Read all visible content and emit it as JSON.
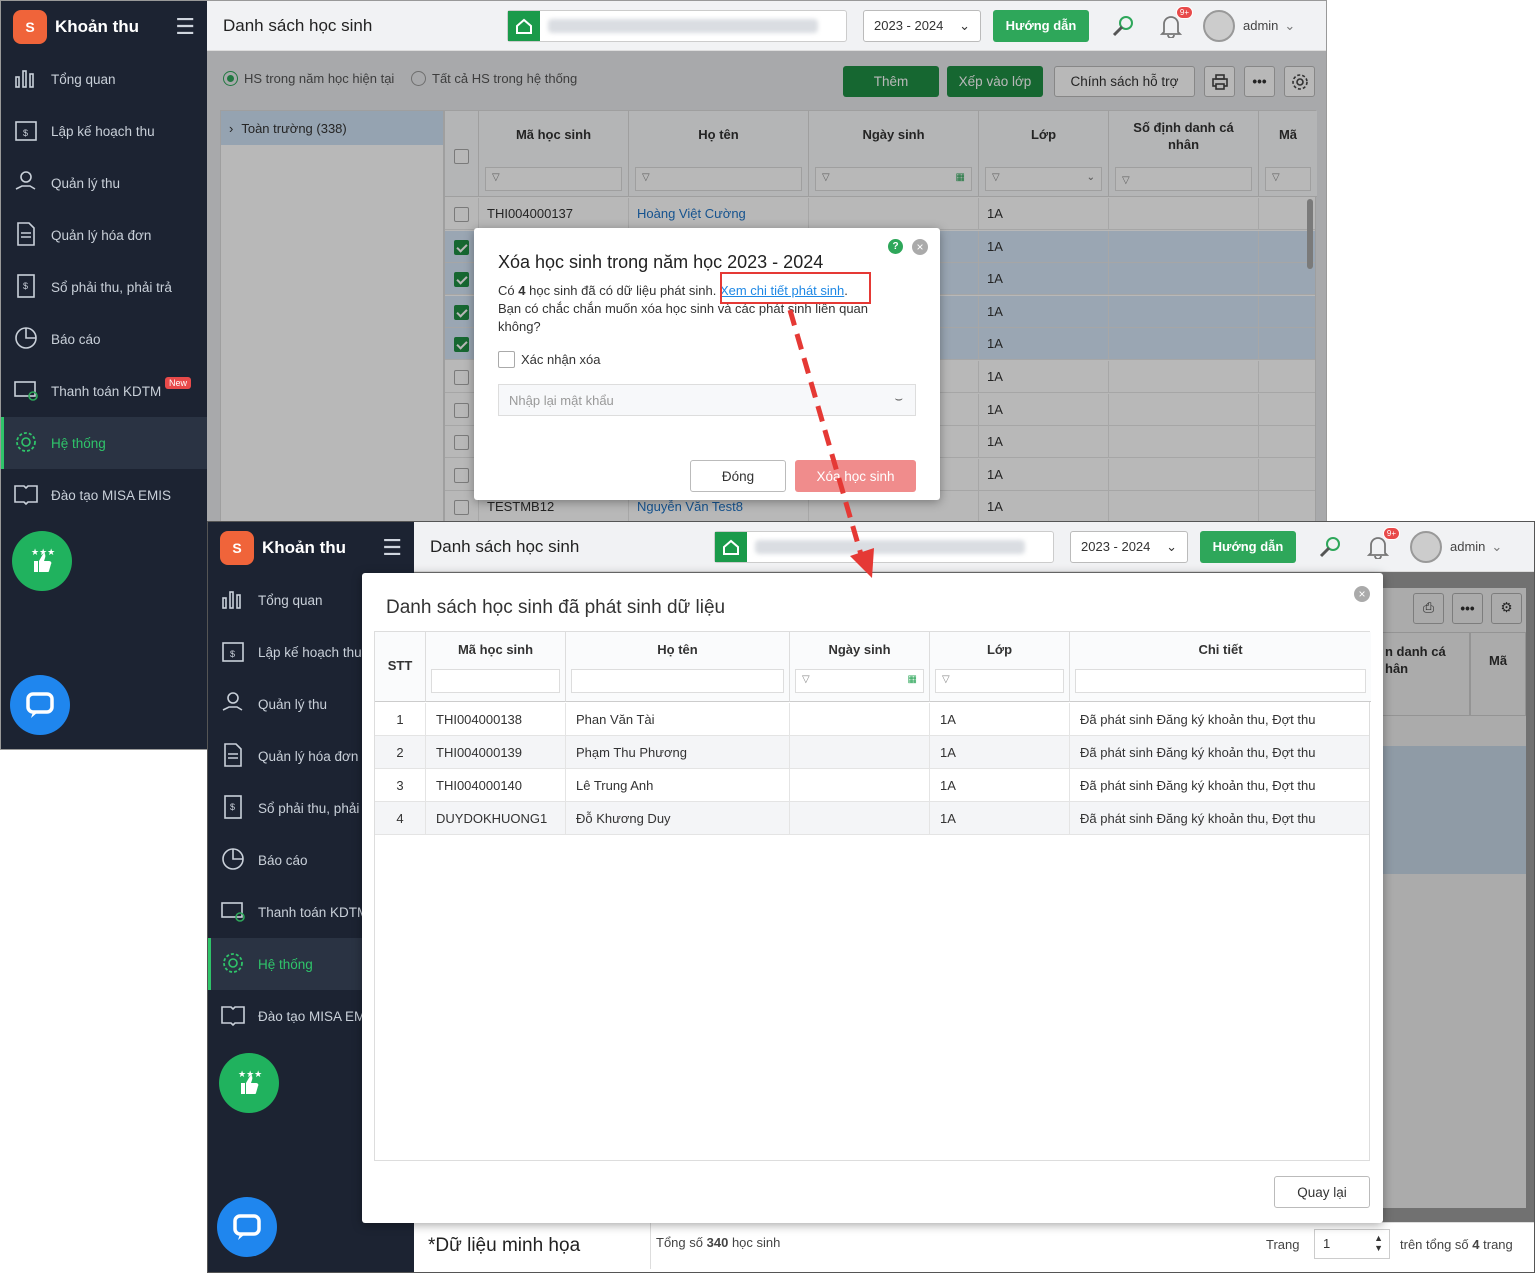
{
  "app": {
    "name": "Khoản thu",
    "logo_text": "S"
  },
  "nav": [
    {
      "label": "Tổng quan",
      "icon": "chart-bars-icon"
    },
    {
      "label": "Lập kế hoạch thu",
      "icon": "calendar-money-icon"
    },
    {
      "label": "Quản lý thu",
      "icon": "hand-coin-icon"
    },
    {
      "label": "Quản lý hóa đơn",
      "icon": "invoice-icon"
    },
    {
      "label": "Sổ phải thu, phải trả",
      "icon": "ledger-icon"
    },
    {
      "label": "Báo cáo",
      "icon": "pie-chart-icon"
    },
    {
      "label": "Thanh toán KDTM",
      "icon": "card-payment-icon",
      "badge": "New"
    },
    {
      "label": "Hệ thống",
      "icon": "gear-icon",
      "active": true
    },
    {
      "label": "Đào tạo MISA EMIS",
      "icon": "book-icon"
    }
  ],
  "nav_b": [
    "Tổng quan",
    "Lập kế hoạch thu",
    "Quản lý thu",
    "Quản lý hóa đơn",
    "Sổ phải thu, phải",
    "Báo cáo",
    "Thanh toán KDTM",
    "Hệ thống",
    "Đào tạo MISA EM"
  ],
  "header": {
    "title": "Danh sách học sinh",
    "year": "2023 - 2024",
    "guide": "Hướng dẫn",
    "bell_badge": "9+",
    "user": "admin"
  },
  "filters": {
    "current_year": "HS trong năm học hiện tại",
    "all": "Tất cả HS trong hệ thống"
  },
  "actions": {
    "add": "Thêm",
    "assign": "Xếp vào lớp",
    "policy": "Chính sách hỗ trợ",
    "more": "•••"
  },
  "tree": {
    "root": "Toàn trường (338)"
  },
  "grid": {
    "headers": {
      "code": "Mã học sinh",
      "name": "Họ tên",
      "dob": "Ngày sinh",
      "class": "Lớp",
      "id": "Số định danh cá nhân",
      "extra": "Mã"
    },
    "rows": [
      {
        "code": "THI004000137",
        "name": "Hoàng Việt Cường",
        "class": "1A",
        "checked": false
      },
      {
        "code": "",
        "name": "",
        "class": "1A",
        "checked": true
      },
      {
        "code": "",
        "name": "",
        "class": "1A",
        "checked": true
      },
      {
        "code": "",
        "name": "",
        "class": "1A",
        "checked": true
      },
      {
        "code": "",
        "name": "",
        "class": "1A",
        "checked": true
      },
      {
        "code": "",
        "name": "",
        "class": "1A",
        "checked": false
      },
      {
        "code": "",
        "name": "",
        "class": "1A",
        "checked": false
      },
      {
        "code": "",
        "name": "",
        "class": "1A",
        "checked": false
      },
      {
        "code": "",
        "name": "",
        "class": "1A",
        "checked": false
      },
      {
        "code": "TESTMB12",
        "name": "Nguyễn Văn Test8",
        "class": "1A",
        "checked": false
      }
    ]
  },
  "delete_dialog": {
    "title": "Xóa học sinh trong năm học 2023 - 2024",
    "msg_prefix": "Có",
    "msg_count": "4",
    "msg_mid": "học sinh đã có dữ liệu phát sinh.",
    "msg_link": "Xem chi tiết phát sinh",
    "msg_line2": "Bạn có chắc chắn muốn xóa học sinh và các phát sinh liên quan",
    "msg_line3": "không?",
    "confirm_label": "Xác nhận xóa",
    "password_placeholder": "Nhập lại mật khẩu",
    "close_btn": "Đóng",
    "delete_btn": "Xóa học sinh"
  },
  "detail_dialog": {
    "title": "Danh sách học sinh đã phát sinh dữ liệu",
    "headers": {
      "stt": "STT",
      "code": "Mã học sinh",
      "name": "Họ tên",
      "dob": "Ngày sinh",
      "class": "Lớp",
      "detail": "Chi tiết"
    },
    "rows": [
      {
        "stt": "1",
        "code": "THI004000138",
        "name": "Phan Văn Tài",
        "class": "1A",
        "detail": "Đã phát sinh Đăng ký khoản thu, Đợt thu"
      },
      {
        "stt": "2",
        "code": "THI004000139",
        "name": "Phạm Thu Phương",
        "class": "1A",
        "detail": "Đã phát sinh Đăng ký khoản thu, Đợt thu"
      },
      {
        "stt": "3",
        "code": "THI004000140",
        "name": "Lê Trung Anh",
        "class": "1A",
        "detail": "Đã phát sinh Đăng ký khoản thu, Đợt thu"
      },
      {
        "stt": "4",
        "code": "DUYDOKHUONG1",
        "name": "Đỗ Khương Duy",
        "class": "1A",
        "detail": "Đã phát sinh Đăng ký khoản thu, Đợt thu"
      }
    ],
    "back_btn": "Quay lại"
  },
  "bg_grid_b": {
    "id_header": "n danh cá\nhân",
    "extra": "Mã"
  },
  "footer": {
    "note": "*Dữ liệu minh họa",
    "total_prefix": "Tổng số",
    "total_count": "340",
    "total_suffix": "học sinh",
    "page_label": "Trang",
    "page_value": "1",
    "pages_prefix": "trên tổng số",
    "pages_count": "4",
    "pages_suffix": "trang"
  },
  "colors": {
    "accent": "#2ea75a",
    "sidebar": "#1c2332",
    "highlight_box": "#e53935",
    "arrow": "#e53935",
    "delete_btn": "#f08c8c"
  }
}
